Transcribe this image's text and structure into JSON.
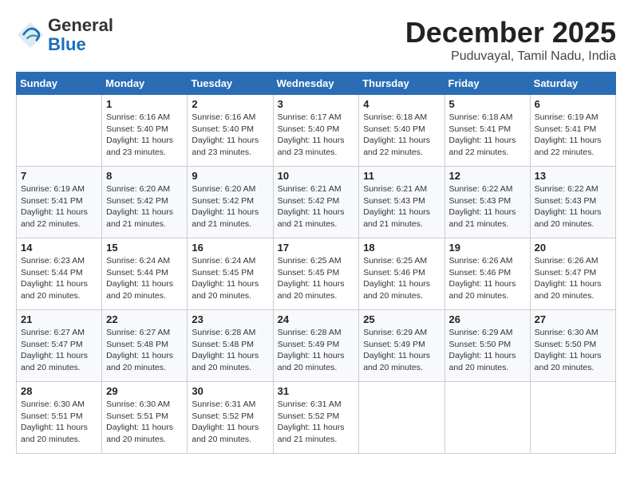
{
  "header": {
    "logo_line1": "General",
    "logo_line2": "Blue",
    "month": "December 2025",
    "location": "Puduvayal, Tamil Nadu, India"
  },
  "weekdays": [
    "Sunday",
    "Monday",
    "Tuesday",
    "Wednesday",
    "Thursday",
    "Friday",
    "Saturday"
  ],
  "weeks": [
    [
      {
        "day": "",
        "info": ""
      },
      {
        "day": "1",
        "info": "Sunrise: 6:16 AM\nSunset: 5:40 PM\nDaylight: 11 hours\nand 23 minutes."
      },
      {
        "day": "2",
        "info": "Sunrise: 6:16 AM\nSunset: 5:40 PM\nDaylight: 11 hours\nand 23 minutes."
      },
      {
        "day": "3",
        "info": "Sunrise: 6:17 AM\nSunset: 5:40 PM\nDaylight: 11 hours\nand 23 minutes."
      },
      {
        "day": "4",
        "info": "Sunrise: 6:18 AM\nSunset: 5:40 PM\nDaylight: 11 hours\nand 22 minutes."
      },
      {
        "day": "5",
        "info": "Sunrise: 6:18 AM\nSunset: 5:41 PM\nDaylight: 11 hours\nand 22 minutes."
      },
      {
        "day": "6",
        "info": "Sunrise: 6:19 AM\nSunset: 5:41 PM\nDaylight: 11 hours\nand 22 minutes."
      }
    ],
    [
      {
        "day": "7",
        "info": "Sunrise: 6:19 AM\nSunset: 5:41 PM\nDaylight: 11 hours\nand 22 minutes."
      },
      {
        "day": "8",
        "info": "Sunrise: 6:20 AM\nSunset: 5:42 PM\nDaylight: 11 hours\nand 21 minutes."
      },
      {
        "day": "9",
        "info": "Sunrise: 6:20 AM\nSunset: 5:42 PM\nDaylight: 11 hours\nand 21 minutes."
      },
      {
        "day": "10",
        "info": "Sunrise: 6:21 AM\nSunset: 5:42 PM\nDaylight: 11 hours\nand 21 minutes."
      },
      {
        "day": "11",
        "info": "Sunrise: 6:21 AM\nSunset: 5:43 PM\nDaylight: 11 hours\nand 21 minutes."
      },
      {
        "day": "12",
        "info": "Sunrise: 6:22 AM\nSunset: 5:43 PM\nDaylight: 11 hours\nand 21 minutes."
      },
      {
        "day": "13",
        "info": "Sunrise: 6:22 AM\nSunset: 5:43 PM\nDaylight: 11 hours\nand 20 minutes."
      }
    ],
    [
      {
        "day": "14",
        "info": "Sunrise: 6:23 AM\nSunset: 5:44 PM\nDaylight: 11 hours\nand 20 minutes."
      },
      {
        "day": "15",
        "info": "Sunrise: 6:24 AM\nSunset: 5:44 PM\nDaylight: 11 hours\nand 20 minutes."
      },
      {
        "day": "16",
        "info": "Sunrise: 6:24 AM\nSunset: 5:45 PM\nDaylight: 11 hours\nand 20 minutes."
      },
      {
        "day": "17",
        "info": "Sunrise: 6:25 AM\nSunset: 5:45 PM\nDaylight: 11 hours\nand 20 minutes."
      },
      {
        "day": "18",
        "info": "Sunrise: 6:25 AM\nSunset: 5:46 PM\nDaylight: 11 hours\nand 20 minutes."
      },
      {
        "day": "19",
        "info": "Sunrise: 6:26 AM\nSunset: 5:46 PM\nDaylight: 11 hours\nand 20 minutes."
      },
      {
        "day": "20",
        "info": "Sunrise: 6:26 AM\nSunset: 5:47 PM\nDaylight: 11 hours\nand 20 minutes."
      }
    ],
    [
      {
        "day": "21",
        "info": "Sunrise: 6:27 AM\nSunset: 5:47 PM\nDaylight: 11 hours\nand 20 minutes."
      },
      {
        "day": "22",
        "info": "Sunrise: 6:27 AM\nSunset: 5:48 PM\nDaylight: 11 hours\nand 20 minutes."
      },
      {
        "day": "23",
        "info": "Sunrise: 6:28 AM\nSunset: 5:48 PM\nDaylight: 11 hours\nand 20 minutes."
      },
      {
        "day": "24",
        "info": "Sunrise: 6:28 AM\nSunset: 5:49 PM\nDaylight: 11 hours\nand 20 minutes."
      },
      {
        "day": "25",
        "info": "Sunrise: 6:29 AM\nSunset: 5:49 PM\nDaylight: 11 hours\nand 20 minutes."
      },
      {
        "day": "26",
        "info": "Sunrise: 6:29 AM\nSunset: 5:50 PM\nDaylight: 11 hours\nand 20 minutes."
      },
      {
        "day": "27",
        "info": "Sunrise: 6:30 AM\nSunset: 5:50 PM\nDaylight: 11 hours\nand 20 minutes."
      }
    ],
    [
      {
        "day": "28",
        "info": "Sunrise: 6:30 AM\nSunset: 5:51 PM\nDaylight: 11 hours\nand 20 minutes."
      },
      {
        "day": "29",
        "info": "Sunrise: 6:30 AM\nSunset: 5:51 PM\nDaylight: 11 hours\nand 20 minutes."
      },
      {
        "day": "30",
        "info": "Sunrise: 6:31 AM\nSunset: 5:52 PM\nDaylight: 11 hours\nand 20 minutes."
      },
      {
        "day": "31",
        "info": "Sunrise: 6:31 AM\nSunset: 5:52 PM\nDaylight: 11 hours\nand 21 minutes."
      },
      {
        "day": "",
        "info": ""
      },
      {
        "day": "",
        "info": ""
      },
      {
        "day": "",
        "info": ""
      }
    ]
  ]
}
